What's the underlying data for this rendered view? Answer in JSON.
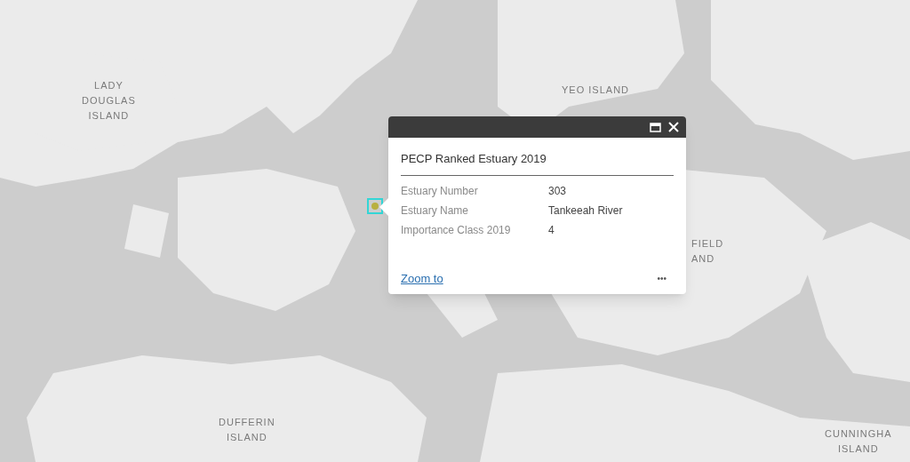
{
  "map_labels": [
    {
      "text": "LADY\nDOUGLAS\nISLAND"
    },
    {
      "text": "YEO ISLAND"
    },
    {
      "text": "FIELD\nAND"
    },
    {
      "text": "DUFFERIN\nISLAND"
    },
    {
      "text": "CUNNINGHA\nISLAND"
    }
  ],
  "popup": {
    "title": "PECP Ranked Estuary 2019",
    "fields": [
      {
        "label": "Estuary Number",
        "value": "303"
      },
      {
        "label": "Estuary Name",
        "value": "Tankeeah River"
      },
      {
        "label": "Importance Class 2019",
        "value": "4"
      }
    ],
    "zoom_link": "Zoom to",
    "menu": "•••"
  }
}
